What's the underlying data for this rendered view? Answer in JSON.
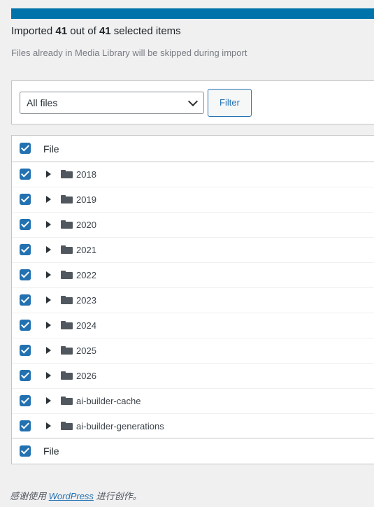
{
  "status": {
    "prefix": "Imported",
    "imported": "41",
    "middle": "out of",
    "total": "41",
    "suffix": "selected items"
  },
  "note": "Files already in Media Library will be skipped during import",
  "filter": {
    "select_value": "All files",
    "button_label": "Filter"
  },
  "table": {
    "header_label": "File",
    "footer_label": "File",
    "rows": [
      {
        "name": "2018"
      },
      {
        "name": "2019"
      },
      {
        "name": "2020"
      },
      {
        "name": "2021"
      },
      {
        "name": "2022"
      },
      {
        "name": "2023"
      },
      {
        "name": "2024"
      },
      {
        "name": "2025"
      },
      {
        "name": "2026"
      },
      {
        "name": "ai-builder-cache"
      },
      {
        "name": "ai-builder-generations"
      }
    ]
  },
  "footer": {
    "prefix": "感谢使用",
    "link": "WordPress",
    "suffix": "进行创作。"
  },
  "colors": {
    "accent": "#2271b1",
    "progress": "#0073aa"
  }
}
